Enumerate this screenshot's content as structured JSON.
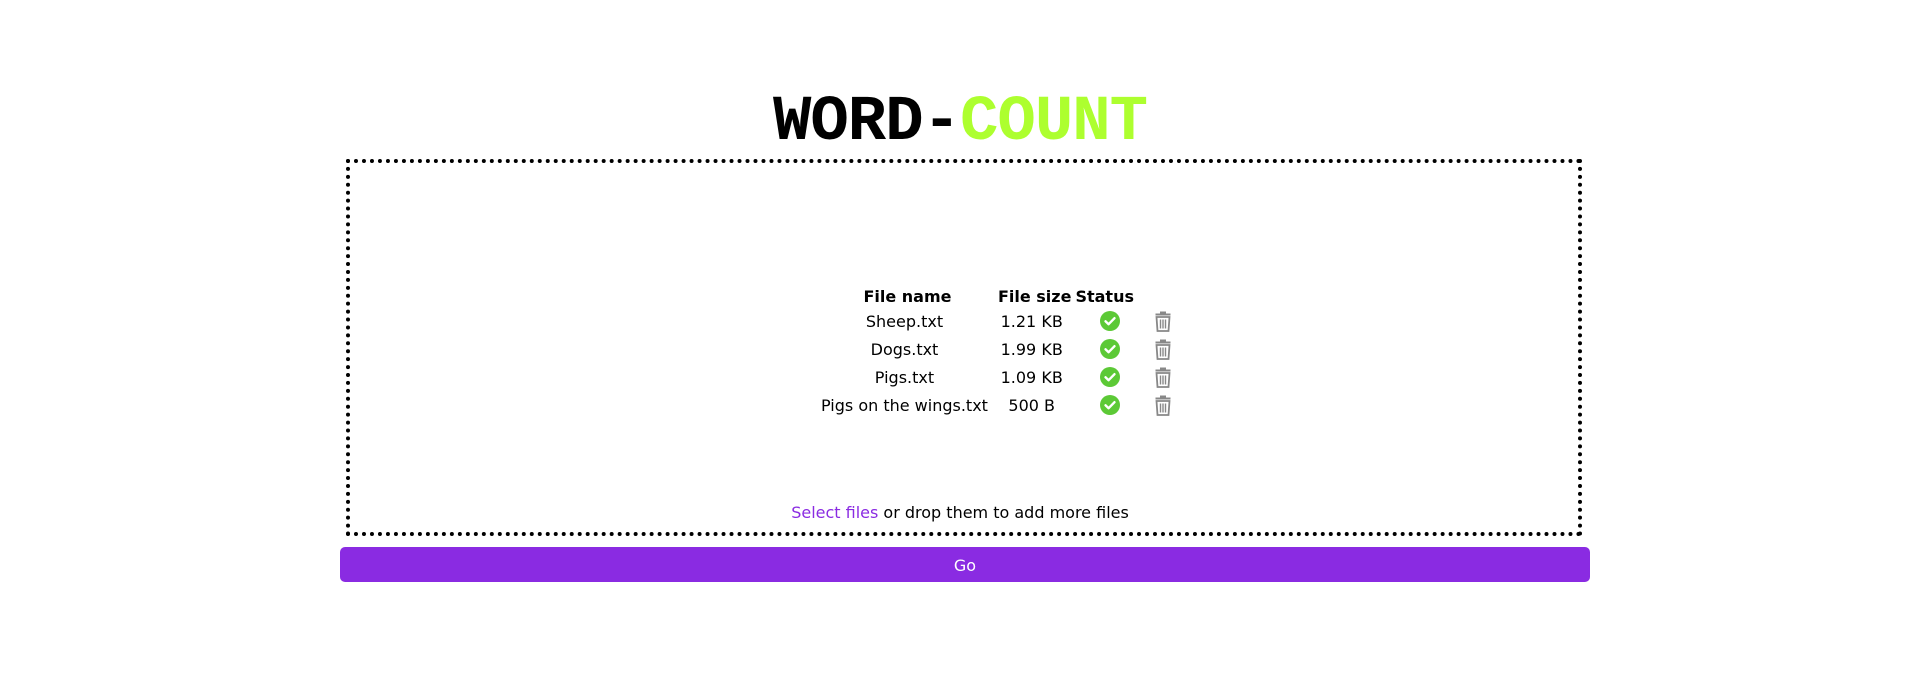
{
  "header": {
    "title_part1": "WORD-",
    "title_part2": "COUNT",
    "title_part1_color": "#000000",
    "title_part2_color": "#adff2f"
  },
  "files_table": {
    "columns": [
      "File name",
      "File size",
      "Status"
    ],
    "rows": [
      {
        "name": "Sheep.txt",
        "size": "1.21 KB",
        "status_icon": "check-circle-icon",
        "delete_icon": "trash-icon"
      },
      {
        "name": "Dogs.txt",
        "size": "1.99 KB",
        "status_icon": "check-circle-icon",
        "delete_icon": "trash-icon"
      },
      {
        "name": "Pigs.txt",
        "size": "1.09 KB",
        "status_icon": "check-circle-icon",
        "delete_icon": "trash-icon"
      },
      {
        "name": "Pigs on the wings.txt",
        "size": "500 B",
        "status_icon": "check-circle-icon",
        "delete_icon": "trash-icon"
      }
    ]
  },
  "dropzone": {
    "select_link": "Select files",
    "hint_rest": " or drop them to add more files"
  },
  "actions": {
    "go_label": "Go"
  },
  "colors": {
    "accent": "#8a2be2",
    "success": "#5cc936",
    "trash": "#888888"
  }
}
